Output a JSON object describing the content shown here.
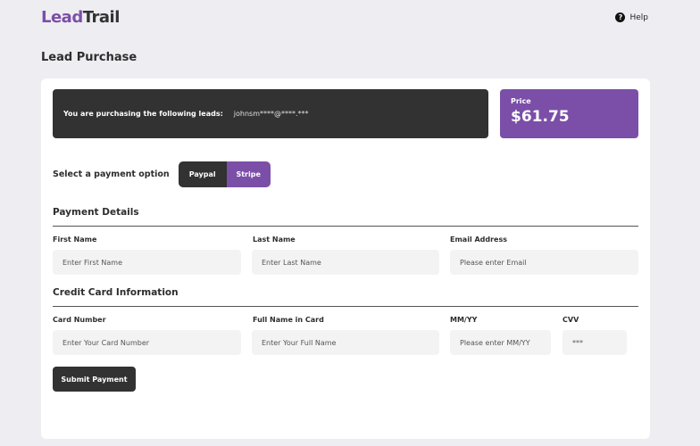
{
  "brand": {
    "name_part1": "Lead",
    "name_part2": "Trail"
  },
  "header": {
    "help_icon_glyph": "?",
    "help_label": "Help"
  },
  "page": {
    "title": "Lead Purchase"
  },
  "purchase": {
    "label": "You are purchasing the following leads:",
    "leads": "johnsm****@****.***",
    "price_label": "Price",
    "price": "$61.75"
  },
  "payment_option": {
    "label": "Select a payment option",
    "options": [
      "Paypal",
      "Stripe"
    ],
    "selected": "Stripe"
  },
  "payment_details": {
    "title": "Payment Details",
    "first_name": {
      "label": "First Name",
      "placeholder": "Enter First Name"
    },
    "last_name": {
      "label": "Last Name",
      "placeholder": "Enter Last Name"
    },
    "email": {
      "label": "Email Address",
      "placeholder": "Please enter Email"
    }
  },
  "credit_card": {
    "title": "Credit Card Information",
    "card_number": {
      "label": "Card Number",
      "placeholder": "Enter Your Card Number"
    },
    "full_name": {
      "label": "Full Name in Card",
      "placeholder": "Enter Your Full Name"
    },
    "expiry": {
      "label": "MM/YY",
      "placeholder": "Please enter MM/YY"
    },
    "cvv": {
      "label": "CVV",
      "placeholder": "***"
    }
  },
  "submit_label": "Submit Payment",
  "colors": {
    "accent": "#7b4fa8",
    "dark": "#323232",
    "background": "#eeedf2"
  }
}
